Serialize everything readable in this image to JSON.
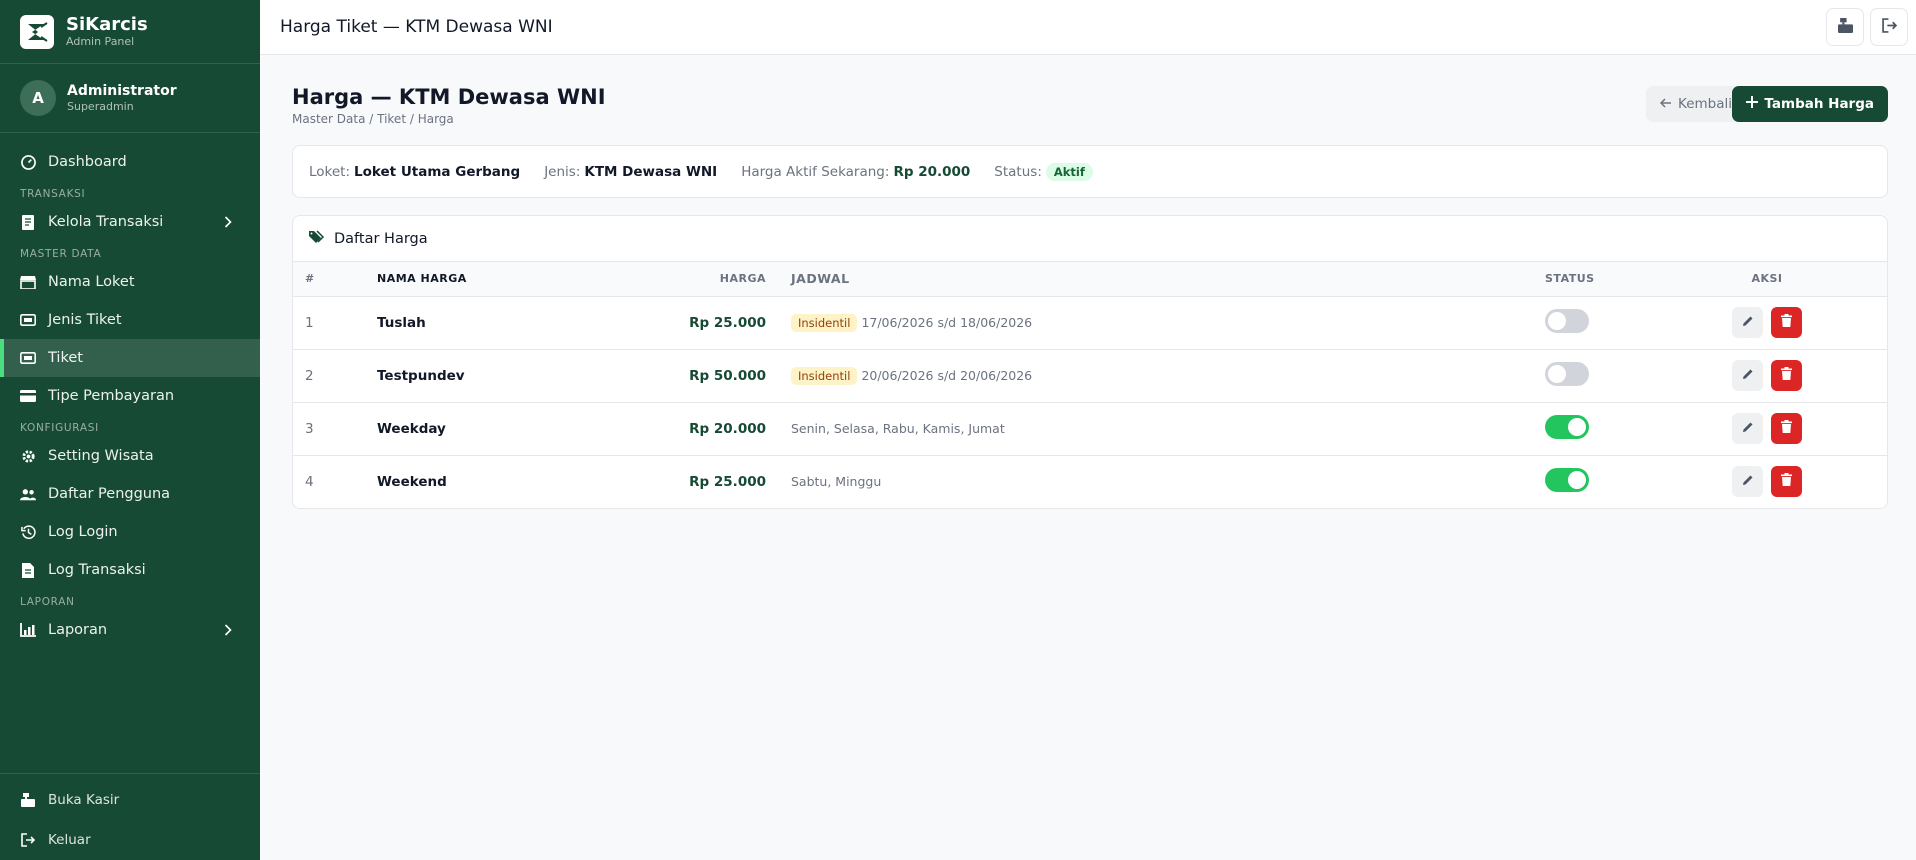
{
  "brand": {
    "name": "SiKarcis",
    "subtitle": "Admin Panel"
  },
  "user": {
    "initial": "A",
    "name": "Administrator",
    "role": "Superadmin"
  },
  "sidebar": {
    "dashboard": "Dashboard",
    "section_transaksi": "TRANSAKSI",
    "kelola_transaksi": "Kelola Transaksi",
    "section_master": "MASTER DATA",
    "nama_loket": "Nama Loket",
    "jenis_tiket": "Jenis Tiket",
    "tiket": "Tiket",
    "tipe_pembayaran": "Tipe Pembayaran",
    "section_konfigurasi": "KONFIGURASI",
    "setting_wisata": "Setting Wisata",
    "daftar_pengguna": "Daftar Pengguna",
    "log_login": "Log Login",
    "log_transaksi": "Log Transaksi",
    "section_laporan": "LAPORAN",
    "laporan": "Laporan",
    "buka_kasir": "Buka Kasir",
    "keluar": "Keluar"
  },
  "topbar": {
    "title": "Harga Tiket — KTM Dewasa WNI"
  },
  "page": {
    "title": "Harga — KTM Dewasa WNI",
    "breadcrumb": "Master Data / Tiket / Harga",
    "back_label": "Kembali",
    "add_label": "Tambah Harga"
  },
  "info": {
    "loket_label": "Loket:",
    "loket_value": "Loket Utama Gerbang",
    "jenis_label": "Jenis:",
    "jenis_value": "KTM Dewasa WNI",
    "harga_label": "Harga Aktif Sekarang:",
    "harga_value": "Rp 20.000",
    "status_label": "Status:",
    "status_value": "Aktif"
  },
  "table": {
    "title": "Daftar Harga",
    "columns": {
      "no": "#",
      "name": "NAMA HARGA",
      "price": "HARGA",
      "schedule": "JADWAL",
      "status": "STATUS",
      "action": "AKSI"
    },
    "rows": [
      {
        "no": "1",
        "name": "Tuslah",
        "price": "Rp 25.000",
        "badge": "Insidentil",
        "schedule": "17/06/2026 s/d 18/06/2026",
        "active": false
      },
      {
        "no": "2",
        "name": "Testpundev",
        "price": "Rp 50.000",
        "badge": "Insidentil",
        "schedule": "20/06/2026 s/d 20/06/2026",
        "active": false
      },
      {
        "no": "3",
        "name": "Weekday",
        "price": "Rp 20.000",
        "badge": "",
        "schedule": "Senin, Selasa, Rabu, Kamis, Jumat",
        "active": true
      },
      {
        "no": "4",
        "name": "Weekend",
        "price": "Rp 25.000",
        "badge": "",
        "schedule": "Sabtu, Minggu",
        "active": true
      }
    ]
  },
  "colors": {
    "primary": "#174a34",
    "accent": "#22c55e",
    "danger": "#dc2626"
  }
}
